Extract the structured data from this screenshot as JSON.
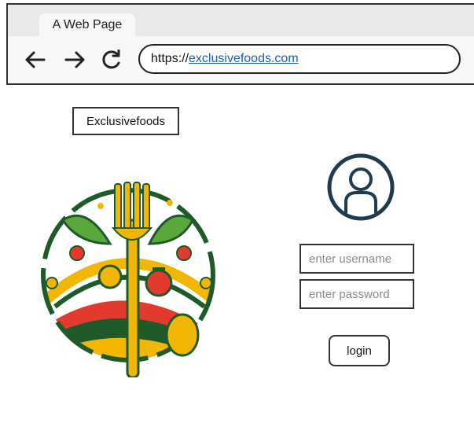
{
  "browser": {
    "tab_title": "A Web Page",
    "address_prefix": "https://",
    "address_link": "exclusivefoods.com",
    "nav": {
      "back_icon": "arrow-left-icon",
      "forward_icon": "arrow-right-icon",
      "reload_icon": "reload-icon"
    }
  },
  "page": {
    "brand_label": "Exclusivefoods",
    "login_form": {
      "username_placeholder": "enter username",
      "password_placeholder": "enter password",
      "login_label": "login"
    }
  },
  "colors": {
    "link": "#1a5fb4",
    "logo_green": "#1e5a2a",
    "logo_yellow": "#f2b705",
    "logo_red": "#e23a2f",
    "avatar": "#1f3b4d"
  }
}
